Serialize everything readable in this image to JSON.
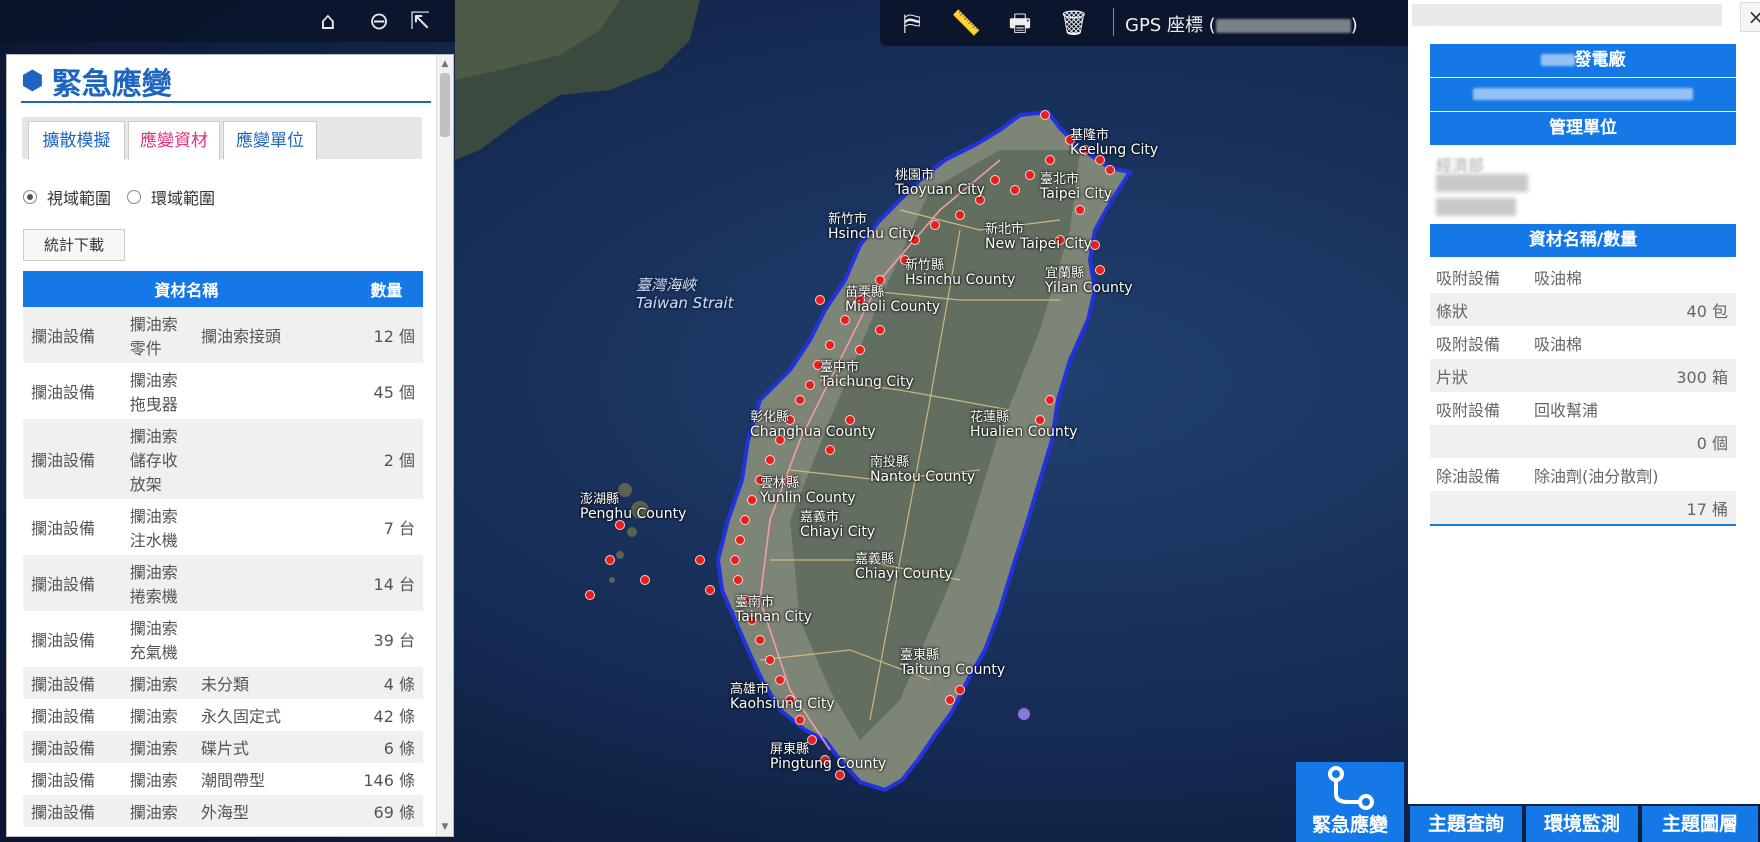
{
  "top_left_toolbar": {
    "icons": [
      "home-icon",
      "minus-circle-icon",
      "share-icon"
    ]
  },
  "top_center_toolbar": {
    "icons": [
      "map-marker-icon",
      "ruler-icon",
      "print-icon",
      "trash-icon"
    ],
    "gps_label": "GPS 座標 (",
    "gps_suffix": ")"
  },
  "map": {
    "strait_label_zh": "臺灣海峽",
    "strait_label_en": "Taiwan Strait",
    "places": [
      {
        "zh": "基隆市",
        "en": "Keelung City"
      },
      {
        "zh": "桃園市",
        "en": "Taoyuan City"
      },
      {
        "zh": "臺北市",
        "en": "Taipei City"
      },
      {
        "zh": "新竹市",
        "en": "Hsinchu City"
      },
      {
        "zh": "新北市",
        "en": "New Taipei City"
      },
      {
        "zh": "新竹縣",
        "en": "Hsinchu County"
      },
      {
        "zh": "宜蘭縣",
        "en": "Yilan County"
      },
      {
        "zh": "苗栗縣",
        "en": "Miaoli County"
      },
      {
        "zh": "臺中市",
        "en": "Taichung City"
      },
      {
        "zh": "彰化縣",
        "en": "Changhua County"
      },
      {
        "zh": "花蓮縣",
        "en": "Hualien County"
      },
      {
        "zh": "南投縣",
        "en": "Nantou County"
      },
      {
        "zh": "雲林縣",
        "en": "Yunlin County"
      },
      {
        "zh": "澎湖縣",
        "en": "Penghu County"
      },
      {
        "zh": "嘉義市",
        "en": "Chiayi City"
      },
      {
        "zh": "嘉義縣",
        "en": "Chiayi County"
      },
      {
        "zh": "臺南市",
        "en": "Tainan City"
      },
      {
        "zh": "臺東縣",
        "en": "Taitung County"
      },
      {
        "zh": "高雄市",
        "en": "Kaohsiung City"
      },
      {
        "zh": "屏東縣",
        "en": "Pingtung County"
      }
    ]
  },
  "left_panel": {
    "title": "緊急應變",
    "tabs": [
      "擴散模擬",
      "應變資材",
      "應變單位"
    ],
    "radios": [
      {
        "label": "視域範圍",
        "checked": true
      },
      {
        "label": "環域範圍",
        "checked": false
      }
    ],
    "download_button": "統計下載",
    "table": {
      "headers": [
        "資材名稱",
        "數量"
      ],
      "rows": [
        {
          "c1": "攔油設備",
          "c2": "攔油索零件",
          "c3": "攔油索接頭",
          "qty": "12 個"
        },
        {
          "c1": "攔油設備",
          "c2": "攔油索拖曳器",
          "c3": "",
          "qty": "45 個"
        },
        {
          "c1": "攔油設備",
          "c2": "攔油索儲存收放架",
          "c3": "",
          "qty": "2 個"
        },
        {
          "c1": "攔油設備",
          "c2": "攔油索注水機",
          "c3": "",
          "qty": "7 台"
        },
        {
          "c1": "攔油設備",
          "c2": "攔油索捲索機",
          "c3": "",
          "qty": "14 台"
        },
        {
          "c1": "攔油設備",
          "c2": "攔油索充氣機",
          "c3": "",
          "qty": "39 台"
        },
        {
          "c1": "攔油設備",
          "c2": "攔油索",
          "c3": "未分類",
          "qty": "4 條"
        },
        {
          "c1": "攔油設備",
          "c2": "攔油索",
          "c3": "永久固定式",
          "qty": "42 條"
        },
        {
          "c1": "攔油設備",
          "c2": "攔油索",
          "c3": "碟片式",
          "qty": "6 條"
        },
        {
          "c1": "攔油設備",
          "c2": "攔油索",
          "c3": "潮間帶型",
          "qty": "146 條"
        },
        {
          "c1": "攔油設備",
          "c2": "攔油索",
          "c3": "外海型",
          "qty": "69 條"
        }
      ]
    }
  },
  "right_panel": {
    "facility_title_suffix": "發電廠",
    "manager_header": "管理單位",
    "manager_visible": "經濟部",
    "materials_header": "資材名稱/數量",
    "items": [
      {
        "cat": "吸附設備",
        "name": "吸油棉",
        "spec": "條狀",
        "qty": "40 包"
      },
      {
        "cat": "吸附設備",
        "name": "吸油棉",
        "spec": "片狀",
        "qty": "300 箱"
      },
      {
        "cat": "吸附設備",
        "name": "回收幫浦",
        "spec": "",
        "qty": "0 個"
      },
      {
        "cat": "除油設備",
        "name": "除油劑(油分散劑)",
        "spec": "",
        "qty": "17 桶"
      }
    ],
    "close_label": "×"
  },
  "bottom_nav": {
    "emergency": "緊急應變",
    "topic_query": "主題查詢",
    "env_monitor": "環境監測",
    "topic_layers": "主題圖層"
  },
  "colors": {
    "accent_blue": "#1478e6",
    "title_blue": "#1d65c1",
    "active_tab_pink": "#e0307a",
    "marker_red": "#e8201c"
  }
}
